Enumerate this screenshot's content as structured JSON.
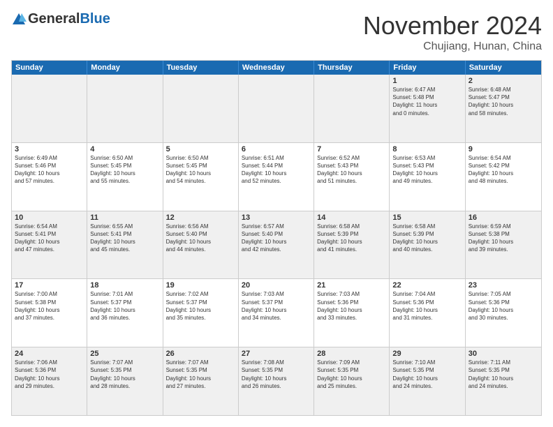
{
  "header": {
    "logo_general": "General",
    "logo_blue": "Blue",
    "month_title": "November 2024",
    "location": "Chujiang, Hunan, China"
  },
  "weekdays": [
    "Sunday",
    "Monday",
    "Tuesday",
    "Wednesday",
    "Thursday",
    "Friday",
    "Saturday"
  ],
  "rows": [
    [
      {
        "day": "",
        "info": ""
      },
      {
        "day": "",
        "info": ""
      },
      {
        "day": "",
        "info": ""
      },
      {
        "day": "",
        "info": ""
      },
      {
        "day": "",
        "info": ""
      },
      {
        "day": "1",
        "info": "Sunrise: 6:47 AM\nSunset: 5:48 PM\nDaylight: 11 hours\nand 0 minutes."
      },
      {
        "day": "2",
        "info": "Sunrise: 6:48 AM\nSunset: 5:47 PM\nDaylight: 10 hours\nand 58 minutes."
      }
    ],
    [
      {
        "day": "3",
        "info": "Sunrise: 6:49 AM\nSunset: 5:46 PM\nDaylight: 10 hours\nand 57 minutes."
      },
      {
        "day": "4",
        "info": "Sunrise: 6:50 AM\nSunset: 5:45 PM\nDaylight: 10 hours\nand 55 minutes."
      },
      {
        "day": "5",
        "info": "Sunrise: 6:50 AM\nSunset: 5:45 PM\nDaylight: 10 hours\nand 54 minutes."
      },
      {
        "day": "6",
        "info": "Sunrise: 6:51 AM\nSunset: 5:44 PM\nDaylight: 10 hours\nand 52 minutes."
      },
      {
        "day": "7",
        "info": "Sunrise: 6:52 AM\nSunset: 5:43 PM\nDaylight: 10 hours\nand 51 minutes."
      },
      {
        "day": "8",
        "info": "Sunrise: 6:53 AM\nSunset: 5:43 PM\nDaylight: 10 hours\nand 49 minutes."
      },
      {
        "day": "9",
        "info": "Sunrise: 6:54 AM\nSunset: 5:42 PM\nDaylight: 10 hours\nand 48 minutes."
      }
    ],
    [
      {
        "day": "10",
        "info": "Sunrise: 6:54 AM\nSunset: 5:41 PM\nDaylight: 10 hours\nand 47 minutes."
      },
      {
        "day": "11",
        "info": "Sunrise: 6:55 AM\nSunset: 5:41 PM\nDaylight: 10 hours\nand 45 minutes."
      },
      {
        "day": "12",
        "info": "Sunrise: 6:56 AM\nSunset: 5:40 PM\nDaylight: 10 hours\nand 44 minutes."
      },
      {
        "day": "13",
        "info": "Sunrise: 6:57 AM\nSunset: 5:40 PM\nDaylight: 10 hours\nand 42 minutes."
      },
      {
        "day": "14",
        "info": "Sunrise: 6:58 AM\nSunset: 5:39 PM\nDaylight: 10 hours\nand 41 minutes."
      },
      {
        "day": "15",
        "info": "Sunrise: 6:58 AM\nSunset: 5:39 PM\nDaylight: 10 hours\nand 40 minutes."
      },
      {
        "day": "16",
        "info": "Sunrise: 6:59 AM\nSunset: 5:38 PM\nDaylight: 10 hours\nand 39 minutes."
      }
    ],
    [
      {
        "day": "17",
        "info": "Sunrise: 7:00 AM\nSunset: 5:38 PM\nDaylight: 10 hours\nand 37 minutes."
      },
      {
        "day": "18",
        "info": "Sunrise: 7:01 AM\nSunset: 5:37 PM\nDaylight: 10 hours\nand 36 minutes."
      },
      {
        "day": "19",
        "info": "Sunrise: 7:02 AM\nSunset: 5:37 PM\nDaylight: 10 hours\nand 35 minutes."
      },
      {
        "day": "20",
        "info": "Sunrise: 7:03 AM\nSunset: 5:37 PM\nDaylight: 10 hours\nand 34 minutes."
      },
      {
        "day": "21",
        "info": "Sunrise: 7:03 AM\nSunset: 5:36 PM\nDaylight: 10 hours\nand 33 minutes."
      },
      {
        "day": "22",
        "info": "Sunrise: 7:04 AM\nSunset: 5:36 PM\nDaylight: 10 hours\nand 31 minutes."
      },
      {
        "day": "23",
        "info": "Sunrise: 7:05 AM\nSunset: 5:36 PM\nDaylight: 10 hours\nand 30 minutes."
      }
    ],
    [
      {
        "day": "24",
        "info": "Sunrise: 7:06 AM\nSunset: 5:36 PM\nDaylight: 10 hours\nand 29 minutes."
      },
      {
        "day": "25",
        "info": "Sunrise: 7:07 AM\nSunset: 5:35 PM\nDaylight: 10 hours\nand 28 minutes."
      },
      {
        "day": "26",
        "info": "Sunrise: 7:07 AM\nSunset: 5:35 PM\nDaylight: 10 hours\nand 27 minutes."
      },
      {
        "day": "27",
        "info": "Sunrise: 7:08 AM\nSunset: 5:35 PM\nDaylight: 10 hours\nand 26 minutes."
      },
      {
        "day": "28",
        "info": "Sunrise: 7:09 AM\nSunset: 5:35 PM\nDaylight: 10 hours\nand 25 minutes."
      },
      {
        "day": "29",
        "info": "Sunrise: 7:10 AM\nSunset: 5:35 PM\nDaylight: 10 hours\nand 24 minutes."
      },
      {
        "day": "30",
        "info": "Sunrise: 7:11 AM\nSunset: 5:35 PM\nDaylight: 10 hours\nand 24 minutes."
      }
    ]
  ]
}
